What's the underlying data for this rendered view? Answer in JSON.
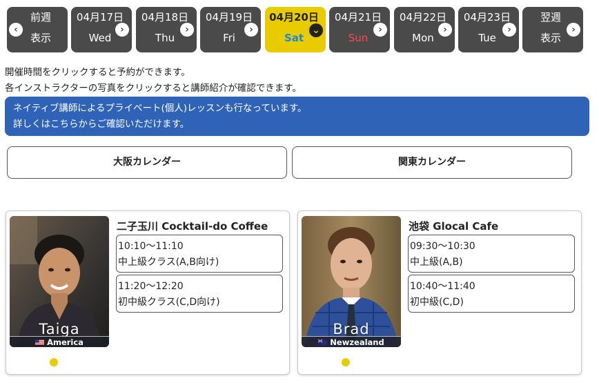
{
  "nav": {
    "prev": {
      "line1": "前週",
      "line2": "表示"
    },
    "days": [
      {
        "date": "04月17日",
        "dow": "Wed",
        "selected": false
      },
      {
        "date": "04月18日",
        "dow": "Thu",
        "selected": false
      },
      {
        "date": "04月19日",
        "dow": "Fri",
        "selected": false
      },
      {
        "date": "04月20日",
        "dow": "Sat",
        "selected": true
      },
      {
        "date": "04月21日",
        "dow": "Sun",
        "selected": false
      },
      {
        "date": "04月22日",
        "dow": "Mon",
        "selected": false
      },
      {
        "date": "04月23日",
        "dow": "Tue",
        "selected": false
      }
    ],
    "next": {
      "line1": "翌週",
      "line2": "表示"
    }
  },
  "info": {
    "line1": "開催時間をクリックすると予約ができます。",
    "line2": "各インストラクターの写真をクリックすると講師紹介が確認できます。"
  },
  "notice": {
    "line1": "ネイティブ講師によるプライベート(個人)レッスンも行なっています。",
    "line2": "詳しくはこちらからご確認いただけます。"
  },
  "calendars": {
    "osaka": "大阪カレンダー",
    "kanto": "関東カレンダー"
  },
  "cards": [
    {
      "instructor": "Taiga",
      "country": "America",
      "venue": "二子玉川 Cocktail-do Coffee",
      "slots": [
        {
          "time": "10:10〜11:10",
          "level": "中上級クラス(A,B向け)"
        },
        {
          "time": "11:20〜12:20",
          "level": "初中級クラス(C,D向け)"
        }
      ]
    },
    {
      "instructor": "Brad",
      "country": "Newzealand",
      "venue": "池袋 Glocal Cafe",
      "slots": [
        {
          "time": "09:30〜10:30",
          "level": "中上級(A,B)"
        },
        {
          "time": "10:40〜11:40",
          "level": "初中級(C,D)"
        }
      ]
    }
  ],
  "colors": {
    "nav_bg": "#4a4a4a",
    "selected_bg": "#e8cc00",
    "sat": "#1e88d8",
    "sun": "#ff4a4a",
    "notice_bg": "#2f63b8"
  }
}
